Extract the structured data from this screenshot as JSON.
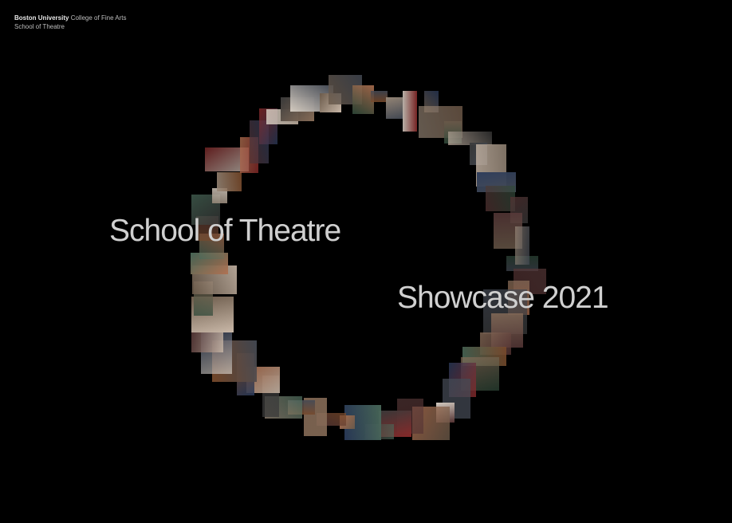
{
  "header": {
    "university": "Boston University",
    "college": "College of Fine Arts",
    "school": "School of Theatre"
  },
  "hero": {
    "line1": "School of Theatre",
    "line2": "Showcase 2021"
  },
  "colors": {
    "background": "#000000",
    "headline": "#d0d0d0",
    "header_text": "#bdbdbd"
  },
  "photo_ring": {
    "description_icon": "photo-collage-ring",
    "tile_count": 60
  }
}
